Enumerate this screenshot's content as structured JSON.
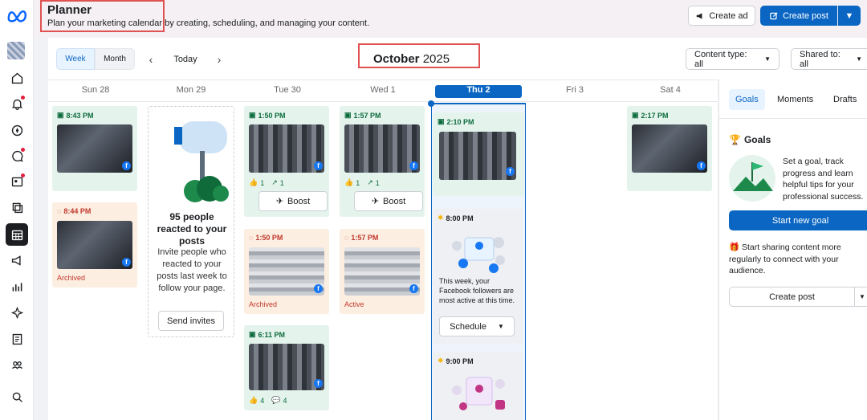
{
  "header": {
    "title": "Planner",
    "subtitle": "Plan your marketing calendar by creating, scheduling, and managing your content.",
    "create_ad": "Create ad",
    "create_post": "Create post"
  },
  "toolbar": {
    "week": "Week",
    "month": "Month",
    "today": "Today",
    "month_name": "October",
    "year": "2025",
    "content_type": "Content type: all",
    "shared_to": "Shared to: all"
  },
  "days": [
    "Sun 28",
    "Mon 29",
    "Tue 30",
    "Wed 1",
    "Thu 2",
    "Fri 3",
    "Sat 4"
  ],
  "cards": {
    "sun_a_time": "8:43 PM",
    "sun_b_time": "8:44 PM",
    "sun_b_status": "Archived",
    "mon_promo_title": "95 people reacted to your posts",
    "mon_promo_body": "Invite people who reacted to your posts last week to follow your page.",
    "mon_promo_btn": "Send invites",
    "tue_a_time": "1:50 PM",
    "tue_a_stat1": "1",
    "tue_a_stat2": "1",
    "tue_boost": "Boost",
    "tue_b_time": "1:50 PM",
    "tue_b_status": "Archived",
    "tue_c_time": "6:11 PM",
    "tue_c_stat1": "4",
    "tue_c_stat2": "4",
    "wed_a_time": "1:57 PM",
    "wed_a_stat1": "1",
    "wed_a_stat2": "1",
    "wed_boost": "Boost",
    "wed_b_time": "1:57 PM",
    "wed_b_status": "Active",
    "thu_a_time": "2:10 PM",
    "thu_b_time": "8:00 PM",
    "thu_b_text": "This week, your Facebook followers are most active at this time.",
    "thu_b_btn": "Schedule",
    "thu_c_time": "9:00 PM",
    "sat_a_time": "2:17 PM"
  },
  "panel": {
    "tabs": [
      "Goals",
      "Moments",
      "Drafts"
    ],
    "goals_heading": "Goals",
    "goals_text": "Set a goal, track progress and learn helpful tips for your professional success.",
    "start_goal": "Start new goal",
    "tip_text": "Start sharing content more regularly to connect with your audience.",
    "create_post": "Create post"
  },
  "colors": {
    "accent": "#0a66c2",
    "highlight_box": "#e05252",
    "published": "#e4f4ec",
    "archived": "#fdeee2"
  }
}
